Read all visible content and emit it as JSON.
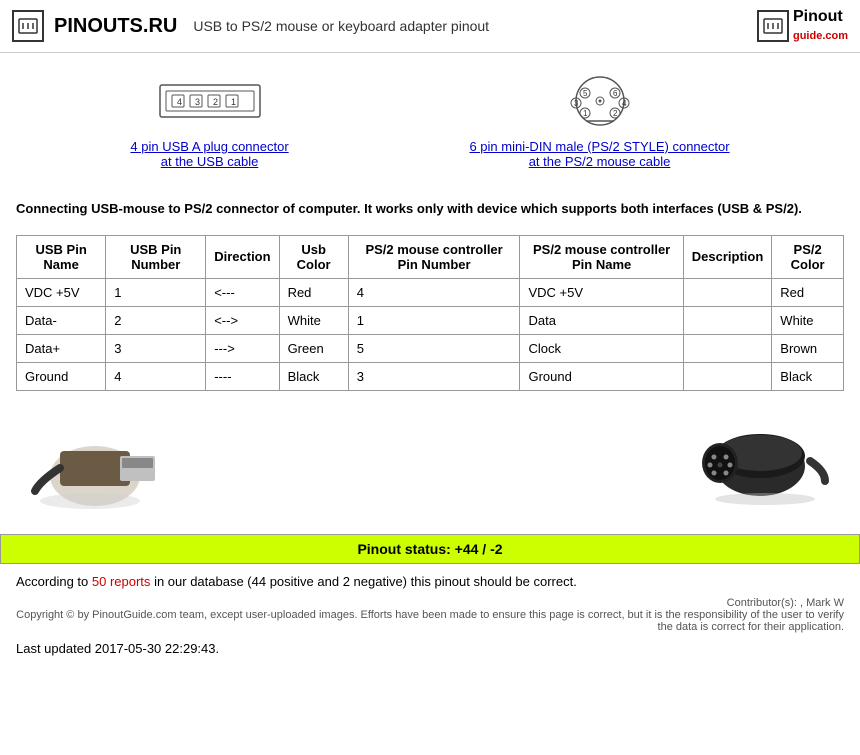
{
  "header": {
    "site_name": "PINOUTS.RU",
    "title": "USB to PS/2 mouse or keyboard adapter pinout",
    "logo_right": "Pinout",
    "logo_right2": "guide.com"
  },
  "connectors": [
    {
      "id": "usb",
      "link_line1": "4 pin USB A plug connector",
      "link_line2": "at the USB cable"
    },
    {
      "id": "ps2",
      "link_line1": "6 pin mini-DIN male (PS/2 STYLE) connector",
      "link_line2": "at the PS/2 mouse cable"
    }
  ],
  "description": "Connecting USB-mouse to PS/2 connector of computer. It works only with device which supports both interfaces (USB & PS/2).",
  "table": {
    "headers": [
      "USB Pin Name",
      "USB Pin Number",
      "Direction",
      "Usb Color",
      "PS/2 mouse controller Pin Number",
      "PS/2 mouse controller Pin Name",
      "Description",
      "PS/2 Color"
    ],
    "rows": [
      [
        "VDC +5V",
        "1",
        "<---",
        "Red",
        "4",
        "VDC +5V",
        "",
        "Red"
      ],
      [
        "Data-",
        "2",
        "<-->",
        "White",
        "1",
        "Data",
        "",
        "White"
      ],
      [
        "Data+",
        "3",
        "--->",
        "Green",
        "5",
        "Clock",
        "",
        "Brown"
      ],
      [
        "Ground",
        "4",
        "----",
        "Black",
        "3",
        "Ground",
        "",
        "Black"
      ]
    ]
  },
  "status": {
    "label": "Pinout status: +44 / -2",
    "according_text": "According to",
    "reports_link": "50 reports",
    "according_rest": " in our database (44 positive and 2 negative) this pinout should be correct.",
    "contributor": "Contributor(s): , Mark W",
    "copyright": "Copyright © by PinoutGuide.com team, except user-uploaded images. Efforts have been made to ensure this page is correct, but it is the responsibility of the user to verify the data is correct for their application.",
    "last_updated": "Last updated 2017-05-30 22:29:43."
  }
}
